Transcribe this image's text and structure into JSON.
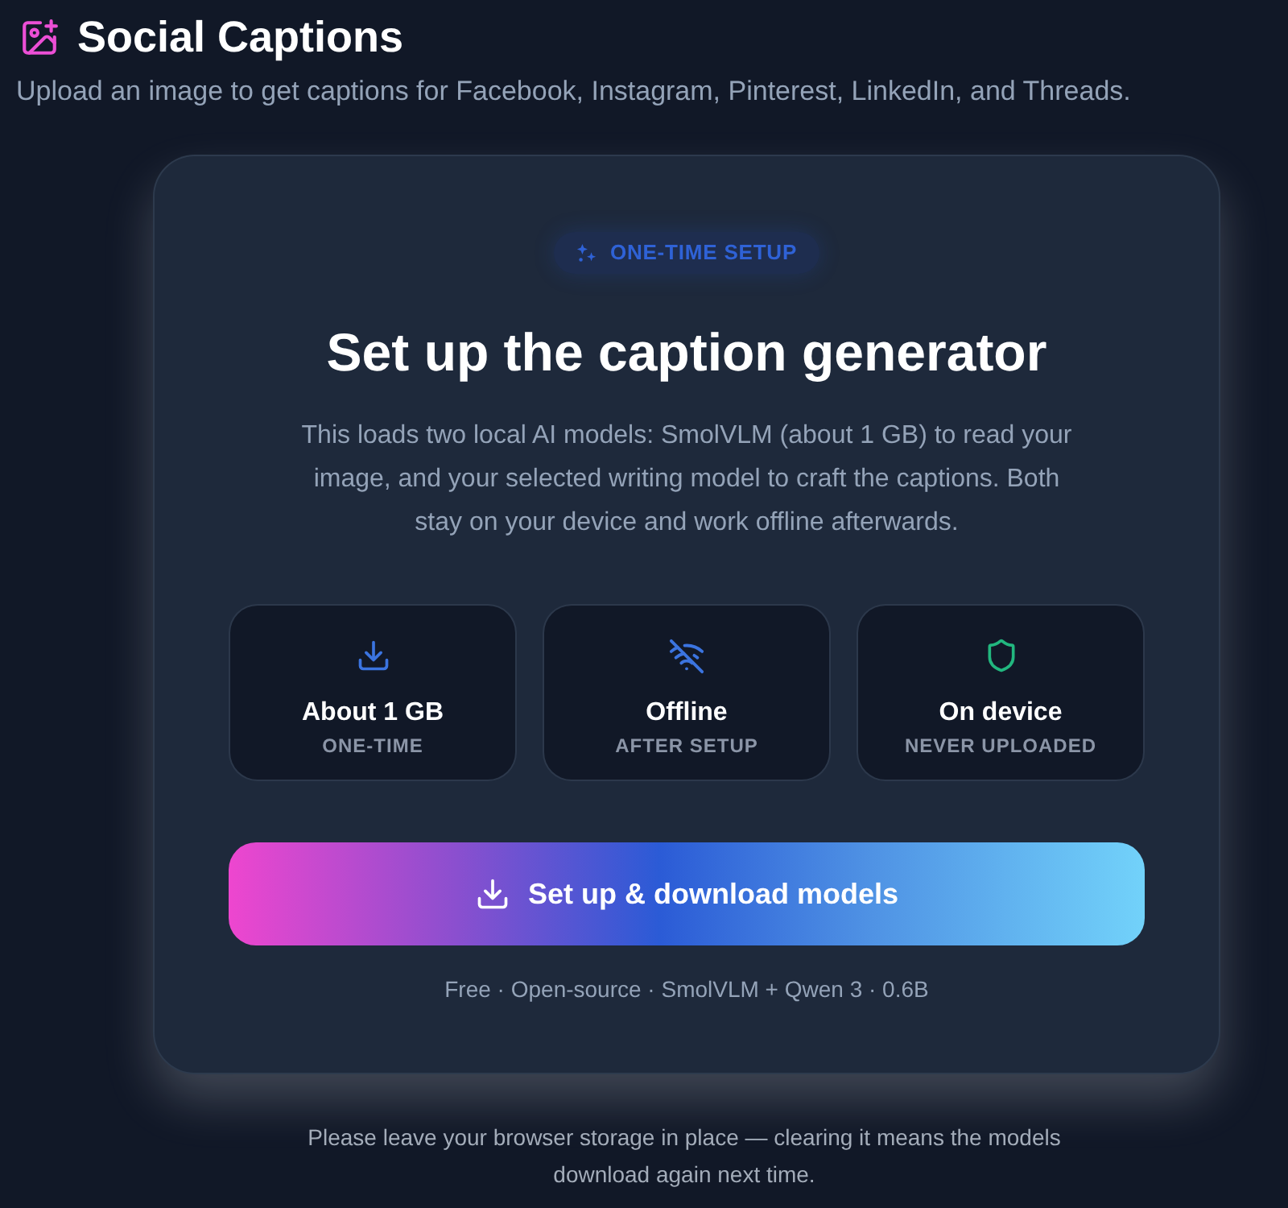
{
  "header": {
    "title": "Social Captions",
    "subtitle": "Upload an image to get captions for Facebook, Instagram, Pinterest, LinkedIn, and Threads."
  },
  "setup_card": {
    "badge": "ONE-TIME SETUP",
    "heading": "Set up the caption generator",
    "description": "This loads two local AI models: SmolVLM (about 1 GB) to read your image, and your selected writing model to craft the captions. Both stay on your device and work offline afterwards.",
    "features": [
      {
        "kind": "download",
        "title": "About 1 GB",
        "caption": "ONE-TIME"
      },
      {
        "kind": "offline",
        "title": "Offline",
        "caption": "AFTER SETUP"
      },
      {
        "kind": "shield",
        "title": "On device",
        "caption": "NEVER UPLOADED"
      }
    ],
    "button": {
      "label": "Set up & download models"
    },
    "footnote": "Free · Open-source · SmolVLM + Qwen 3 · 0.6B"
  },
  "storage_note": "Please leave your browser storage in place — clearing it means the models download again next time."
}
